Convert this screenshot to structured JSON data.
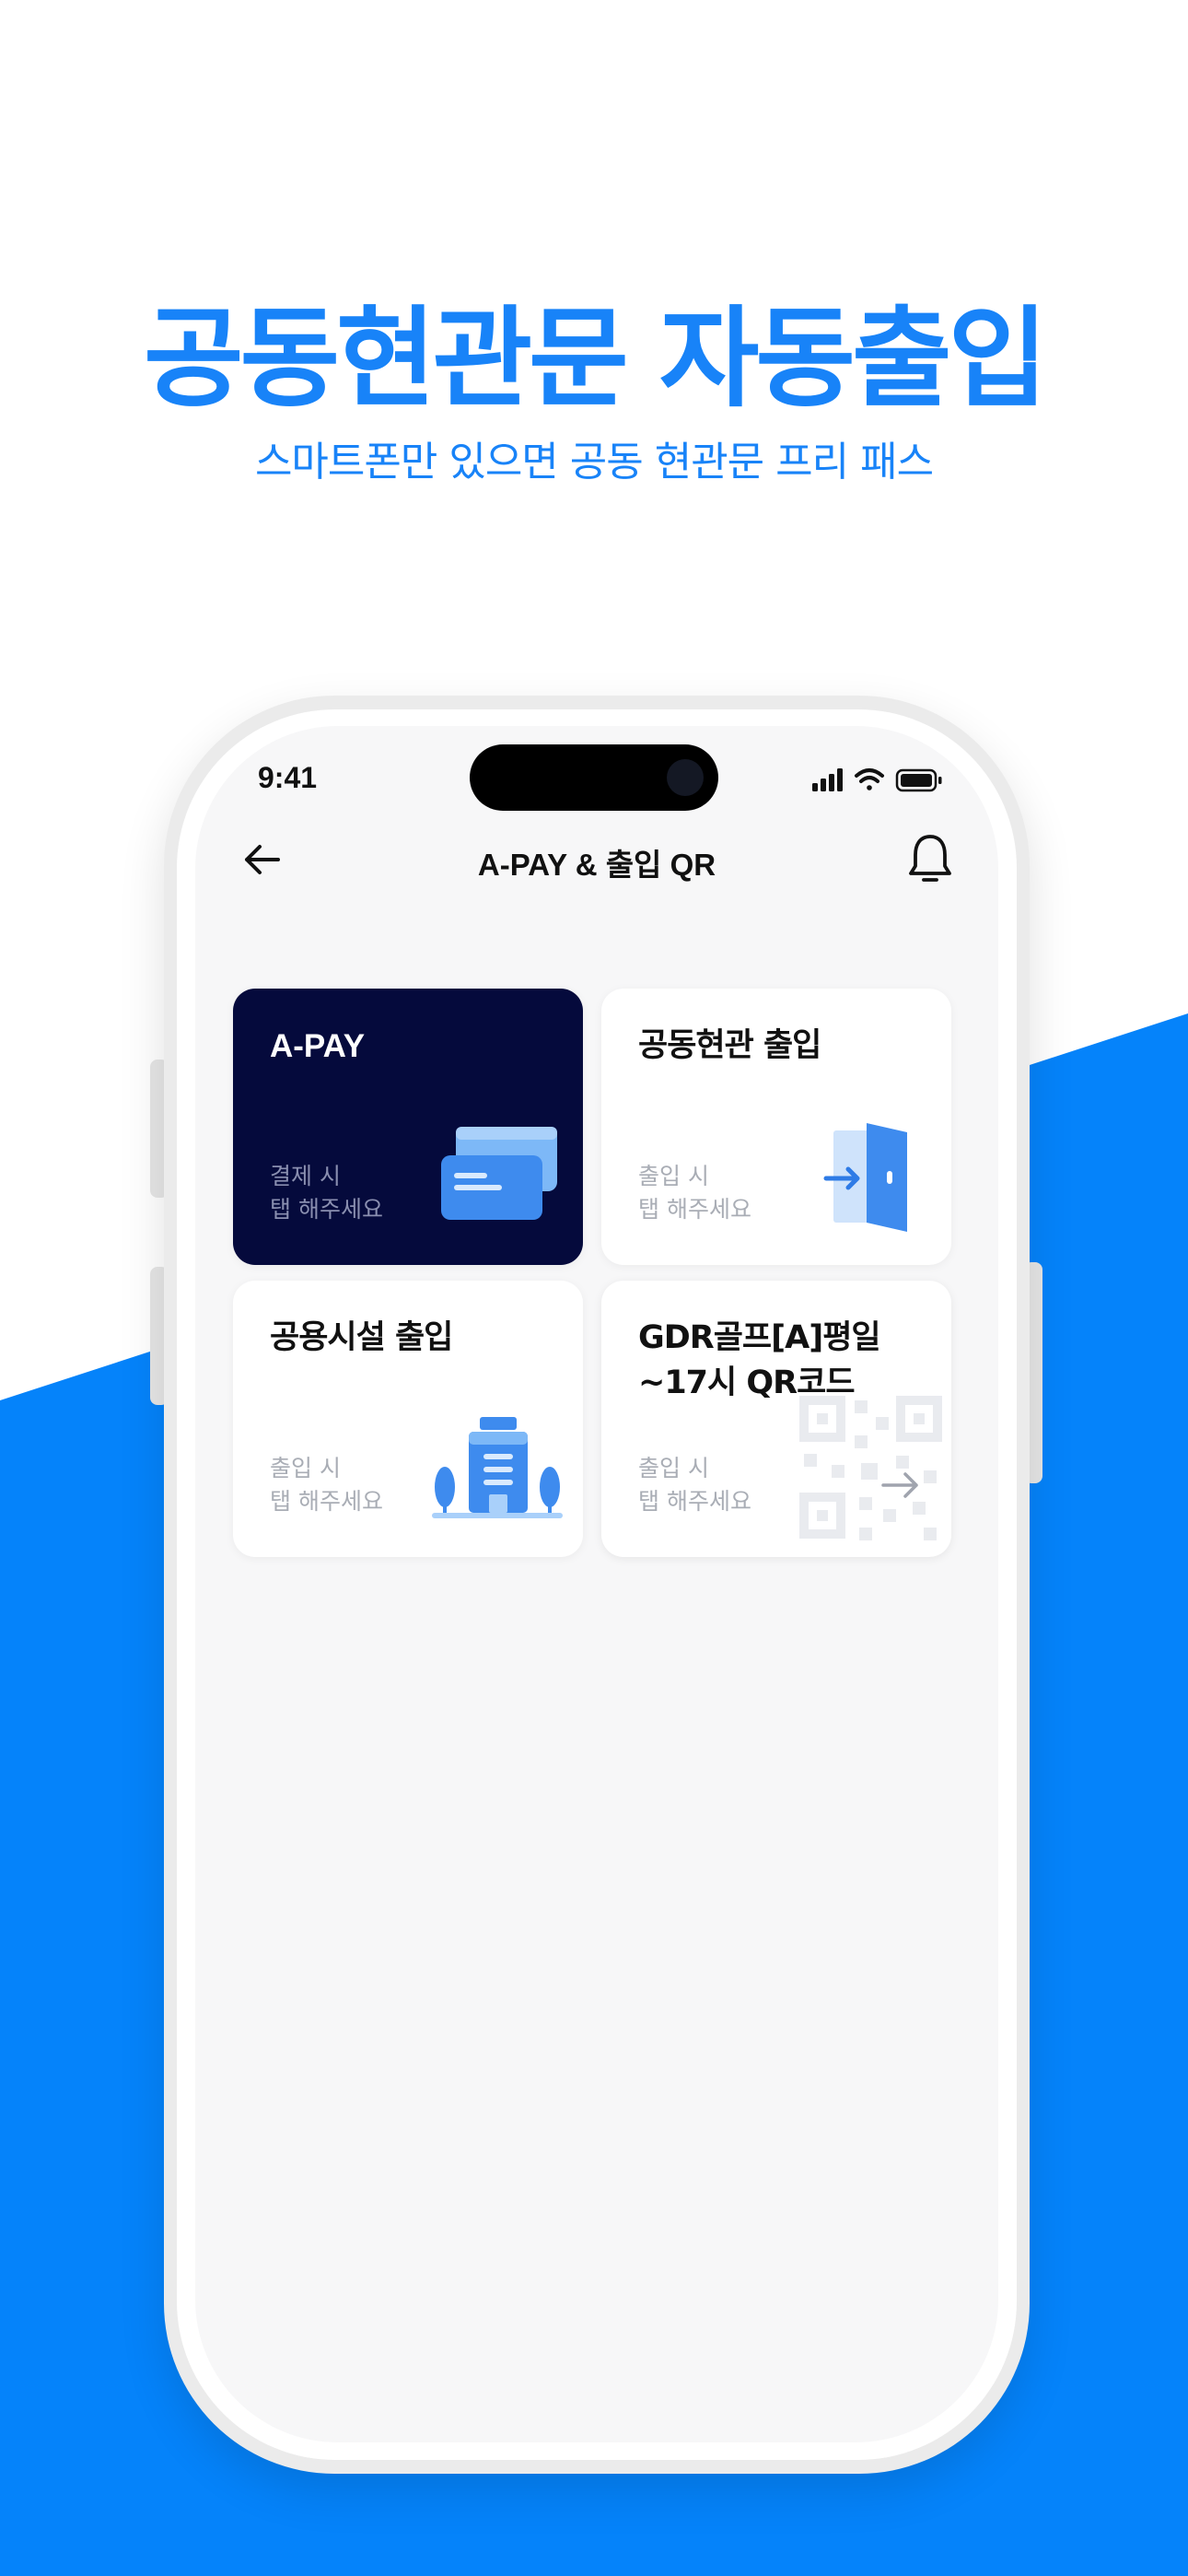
{
  "banner": {
    "headline": "공동현관문 자동출입",
    "subhead": "스마트폰만 있으면 공동 현관문 프리 패스"
  },
  "status_bar": {
    "time": "9:41"
  },
  "nav": {
    "title": "A-PAY & 출입 QR",
    "back_icon": "arrow-left-icon",
    "bell_icon": "bell-icon"
  },
  "cards": [
    {
      "title": "A-PAY",
      "hint_line1": "결제 시",
      "hint_line2": "탭 해주세요",
      "icon": "card-stack-icon"
    },
    {
      "title": "공동현관 출입",
      "hint_line1": "출입 시",
      "hint_line2": "탭 해주세요",
      "icon": "door-enter-icon"
    },
    {
      "title": "공용시설 출입",
      "hint_line1": "출입 시",
      "hint_line2": "탭 해주세요",
      "icon": "building-icon"
    },
    {
      "title": "GDR골프[A]평일~17시 QR코드",
      "hint_line1": "출입 시",
      "hint_line2": "탭 해주세요",
      "icon": "qr-code-icon"
    }
  ],
  "colors": {
    "accent": "#1883F8",
    "dark_card": "#050A3C",
    "screen_bg": "#F7F7F8",
    "icon_blue": "#3E8BEE"
  }
}
